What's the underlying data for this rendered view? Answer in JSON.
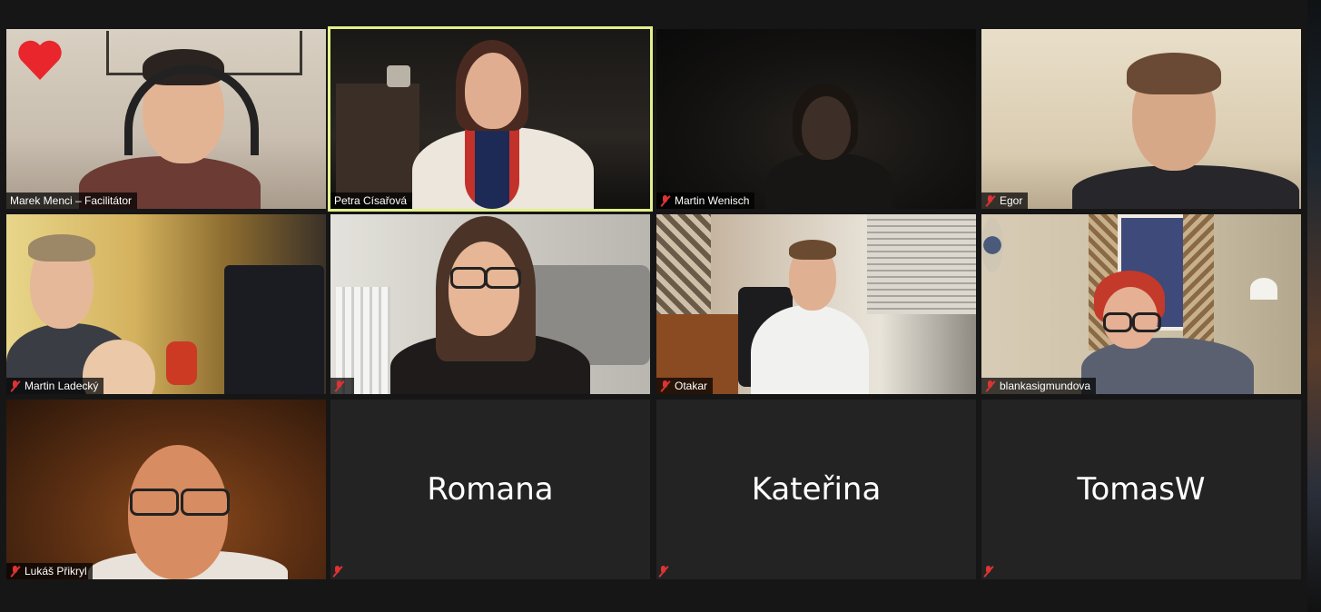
{
  "meeting": {
    "reaction": "heart",
    "active_speaker_index": 1,
    "tiles": [
      {
        "name": "Marek Menci – Facilitátor",
        "muted": false,
        "video": true
      },
      {
        "name": "Petra Císařová",
        "muted": false,
        "video": true
      },
      {
        "name": "Martin Wenisch",
        "muted": true,
        "video": true
      },
      {
        "name": "Egor",
        "muted": true,
        "video": true
      },
      {
        "name": "Martin Ladecký",
        "muted": true,
        "video": true
      },
      {
        "name": "",
        "muted": true,
        "video": true
      },
      {
        "name": "Otakar",
        "muted": true,
        "video": true
      },
      {
        "name": "blankasigmundova",
        "muted": true,
        "video": true
      },
      {
        "name": "Lukáš Přikryl",
        "muted": true,
        "video": true
      },
      {
        "name": "Romana",
        "muted": true,
        "video": false
      },
      {
        "name": "Kateřina",
        "muted": true,
        "video": false
      },
      {
        "name": "TomasW",
        "muted": true,
        "video": false
      }
    ]
  },
  "colors": {
    "background": "#161616",
    "tile_off": "#232323",
    "active_border": "#e3f08a",
    "muted_icon": "#dd3333",
    "heart": "#e8262c"
  }
}
